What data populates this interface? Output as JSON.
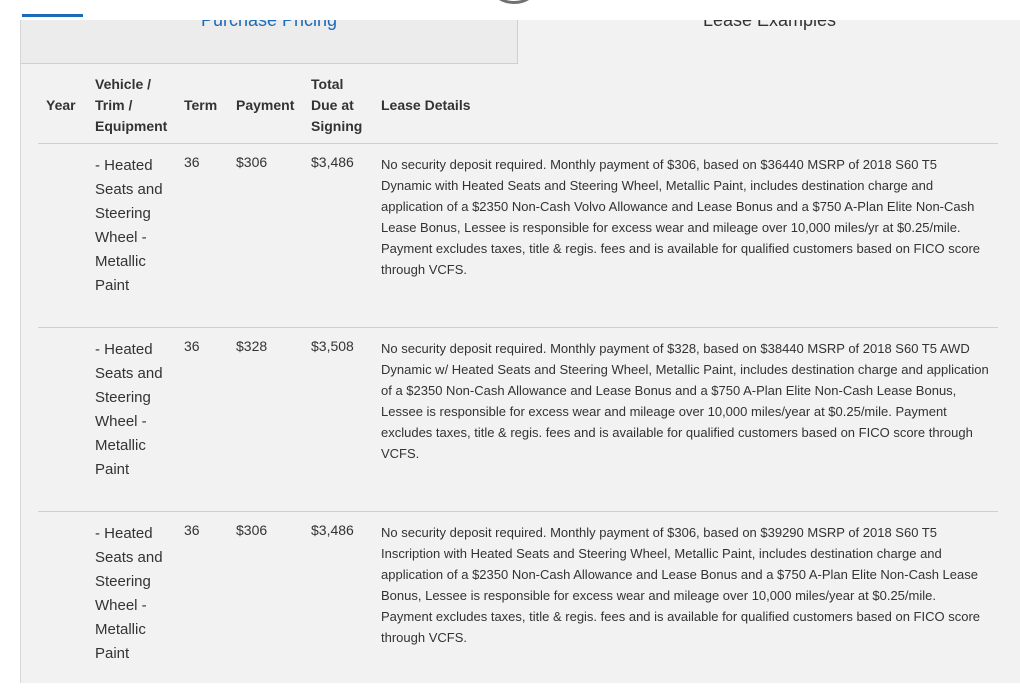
{
  "tabs": {
    "purchase_label": "Purchase Pricing",
    "lease_label": "Lease Examples"
  },
  "table": {
    "headers": {
      "year": "Year",
      "vehicle": "Vehicle / Trim / Equipment",
      "term": "Term",
      "payment": "Payment",
      "due": "Total Due at Signing",
      "details": "Lease Details"
    },
    "rows": [
      {
        "year": "",
        "vehicle": "- Heated Seats and Steering Wheel - Metallic Paint",
        "term": "36",
        "payment": "$306",
        "due": "$3,486",
        "details": "No security deposit required. Monthly payment of $306, based on $36440 MSRP of 2018 S60 T5 Dynamic with Heated Seats and Steering Wheel, Metallic Paint, includes destination charge and application of a $2350 Non-Cash Volvo Allowance and Lease Bonus and a $750 A-Plan Elite Non-Cash Lease Bonus, Lessee is responsible for excess wear and mileage over 10,000 miles/yr at $0.25/mile. Payment excludes taxes, title & regis. fees and is available for qualified customers based on FICO score through VCFS."
      },
      {
        "year": "",
        "vehicle": "- Heated Seats and Steering Wheel - Metallic Paint",
        "term": "36",
        "payment": "$328",
        "due": "$3,508",
        "details": "No security deposit required. Monthly payment of $328, based on $38440 MSRP of 2018 S60 T5 AWD Dynamic w/ Heated Seats and Steering Wheel, Metallic Paint, includes destination charge and application of a $2350 Non-Cash Allowance and Lease Bonus and a $750 A-Plan Elite Non-Cash Lease Bonus, Lessee is responsible for excess wear and mileage over 10,000 miles/year at $0.25/mile. Payment excludes taxes, title & regis. fees and is available for qualified customers based on FICO score through VCFS."
      },
      {
        "year": "",
        "vehicle": "- Heated Seats and Steering Wheel - Metallic Paint",
        "term": "36",
        "payment": "$306",
        "due": "$3,486",
        "details": "No security deposit required. Monthly payment of $306, based on $39290 MSRP of 2018 S60 T5 Inscription with Heated Seats and Steering Wheel, Metallic Paint, includes destination charge and application of a $2350 Non-Cash Allowance and Lease Bonus and a $750 A-Plan Elite Non-Cash Lease Bonus, Lessee is responsible for excess wear and mileage over 10,000 miles/year at $0.25/mile. Payment excludes taxes, title & regis. fees and is available for qualified customers based on FICO score through VCFS."
      }
    ]
  },
  "colors": {
    "accent": "#1c6bba",
    "panel_bg": "#f2f2f2",
    "row_divider": "#cfcfcf"
  }
}
